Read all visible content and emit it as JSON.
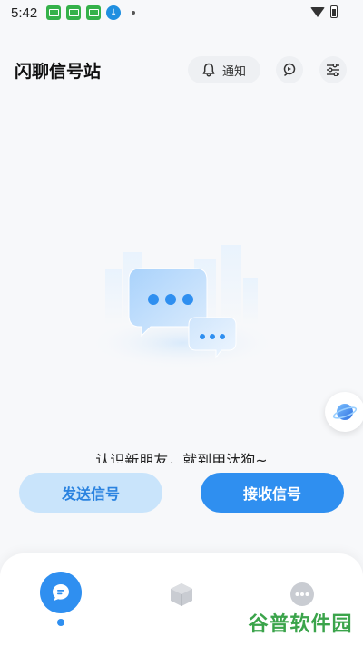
{
  "status_bar": {
    "time": "5:42",
    "icons": [
      "app-notification-icon",
      "app-notification-icon",
      "app-notification-icon",
      "download-icon",
      "dot-icon",
      "wifi-icon",
      "battery-icon"
    ]
  },
  "header": {
    "title": "闪聊信号站",
    "notify_label": "通知",
    "icons": {
      "notify": "bell-icon",
      "explore": "explore-icon",
      "filter": "filter-icon"
    }
  },
  "main": {
    "empty_text": "认识新朋友，就到甲汰狗~"
  },
  "actions": {
    "send_label": "发送信号",
    "receive_label": "接收信号"
  },
  "bottom_nav": {
    "items": [
      {
        "icon": "chat-icon",
        "active": true
      },
      {
        "icon": "cube-icon",
        "active": false
      },
      {
        "icon": "more-icon",
        "active": false
      }
    ]
  },
  "watermark": "谷普软件园",
  "colors": {
    "accent": "#2f8ff0",
    "accent_light": "#c9e4fb",
    "background": "#f7f8fa",
    "watermark": "#3ba44b"
  }
}
